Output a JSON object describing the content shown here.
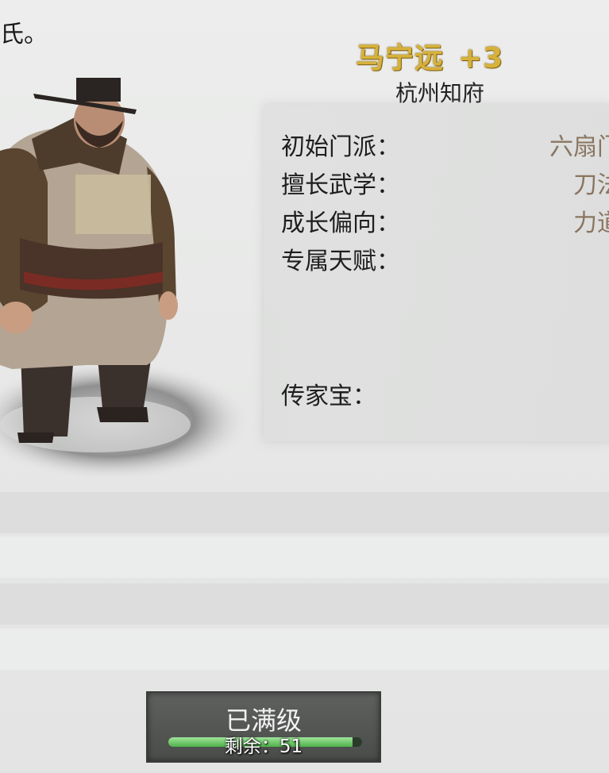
{
  "top_left_text": "氏。",
  "character": {
    "name": "马宁远",
    "level": "+3",
    "title": "杭州知府"
  },
  "info": [
    {
      "label": "初始门派：",
      "value": "六扇门"
    },
    {
      "label": "擅长武学：",
      "value": "刀法"
    },
    {
      "label": "成长偏向：",
      "value": "力道"
    },
    {
      "label": "专属天赋：",
      "value": ""
    },
    {
      "label": "传家宝：",
      "value": ""
    }
  ],
  "level_button": {
    "status": "已满级",
    "remaining": "剩余：51",
    "progress": 0.95
  },
  "colors": {
    "name": "#d7b23a",
    "value": "#8a7560",
    "progress": "#5cc257"
  }
}
